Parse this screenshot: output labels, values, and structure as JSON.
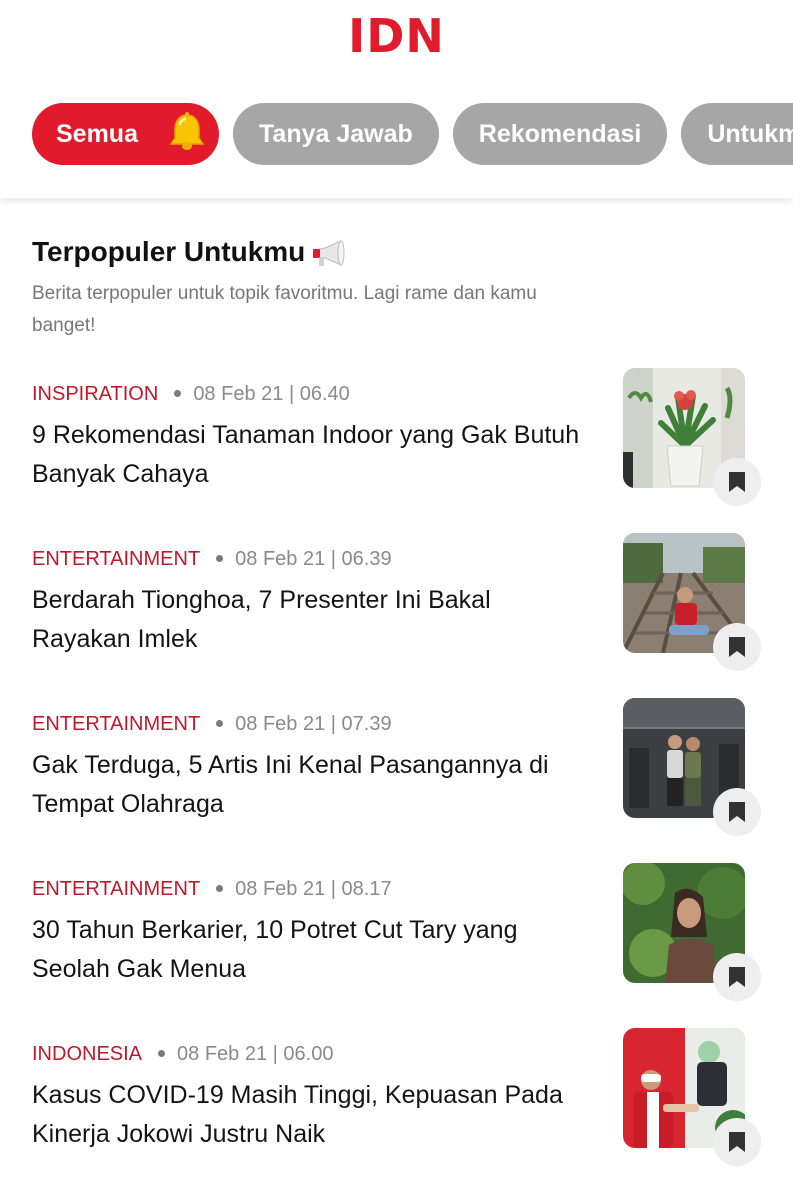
{
  "header": {
    "logo": "IDN"
  },
  "tabs": [
    {
      "label": "Semua",
      "active": true,
      "icon": "bell-icon"
    },
    {
      "label": "Tanya Jawab",
      "active": false
    },
    {
      "label": "Rekomendasi",
      "active": false
    },
    {
      "label": "Untukmu",
      "active": false
    }
  ],
  "section": {
    "title": "Terpopuler Untukmu",
    "title_icon": "megaphone-icon",
    "subtitle": "Berita terpopuler untuk topik favoritmu. Lagi rame dan kamu banget!"
  },
  "articles": [
    {
      "category": "INSPIRATION",
      "date": "08 Feb 21 | 06.40",
      "title": "9 Rekomendasi Tanaman Indoor yang Gak Butuh Banyak Cahaya",
      "thumb_icon": "plant-photo"
    },
    {
      "category": "ENTERTAINMENT",
      "date": "08 Feb 21 | 06.39",
      "title": "Berdarah Tionghoa, 7 Presenter Ini Bakal Rayakan Imlek",
      "thumb_icon": "railway-photo"
    },
    {
      "category": "ENTERTAINMENT",
      "date": "08 Feb 21 | 07.39",
      "title": "Gak Terduga, 5 Artis Ini Kenal Pasangannya di Tempat Olahraga",
      "thumb_icon": "gym-photo"
    },
    {
      "category": "ENTERTAINMENT",
      "date": "08 Feb 21 | 08.17",
      "title": "30 Tahun Berkarier, 10 Potret Cut Tary yang Seolah Gak Menua",
      "thumb_icon": "portrait-photo"
    },
    {
      "category": "INDONESIA",
      "date": "08 Feb 21 | 06.00",
      "title": "Kasus COVID-19 Masih Tinggi, Kepuasan Pada Kinerja Jokowi Justru Naik",
      "thumb_icon": "vaccine-photo"
    }
  ],
  "colors": {
    "brand": "#e21b2c",
    "category": "#c0182a",
    "chip_inactive": "#a6a6a6",
    "meta": "#8a8a8a"
  }
}
